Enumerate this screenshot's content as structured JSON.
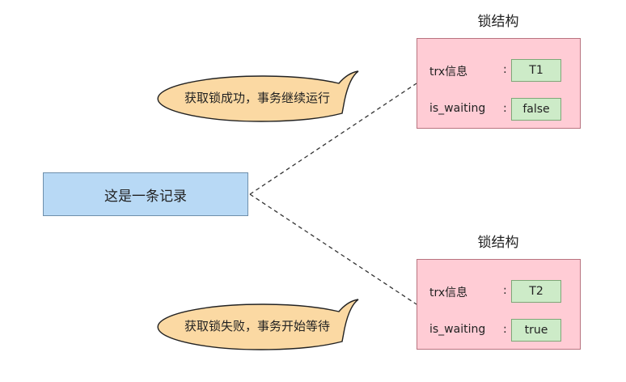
{
  "record": {
    "label": "这是一条记录"
  },
  "locks": [
    {
      "title": "锁结构",
      "fields": [
        {
          "label": "trx信息",
          "separator": ":",
          "value": "T1"
        },
        {
          "label": "is_waiting",
          "separator": ":",
          "value": "false"
        }
      ],
      "callout": "获取锁成功，事务继续运行"
    },
    {
      "title": "锁结构",
      "fields": [
        {
          "label": "trx信息",
          "separator": ":",
          "value": "T2"
        },
        {
          "label": "is_waiting",
          "separator": ":",
          "value": "true"
        }
      ],
      "callout": "获取锁失败，事务开始等待"
    }
  ],
  "colors": {
    "record_fill": "#b8d9f5",
    "lock_fill": "#ffccd5",
    "value_fill": "#cdebc8",
    "bubble_fill": "#fbd9a3"
  }
}
